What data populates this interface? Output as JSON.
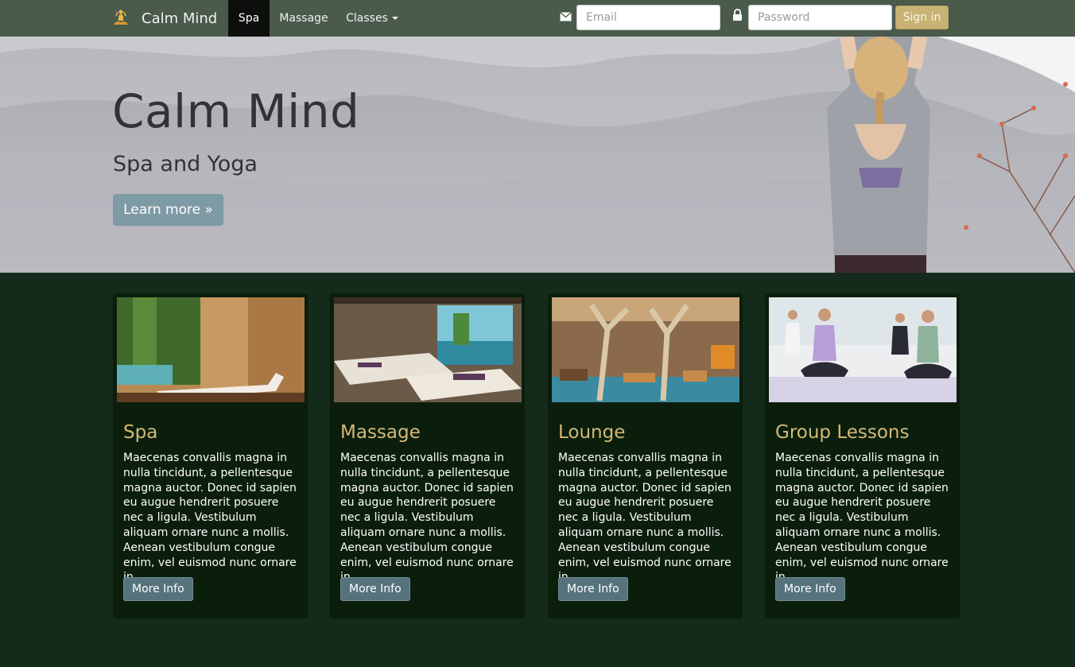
{
  "nav": {
    "brand": "Calm Mind",
    "links": [
      {
        "label": "Spa",
        "active": true
      },
      {
        "label": "Massage",
        "active": false
      },
      {
        "label": "Classes",
        "active": false
      }
    ],
    "email_placeholder": "Email",
    "password_placeholder": "Password",
    "signin_label": "Sign in",
    "brand_icon": "meditation-figure-icon",
    "email_icon": "envelope-icon",
    "password_icon": "lock-icon"
  },
  "hero": {
    "title": "Calm Mind",
    "subtitle": "Spa and Yoga",
    "button_label": "Learn more »"
  },
  "cards": [
    {
      "title": "Spa",
      "text": "Maecenas convallis magna in nulla tincidunt, a pellentesque magna auctor. Donec id sapien eu augue hendrerit posuere nec a ligula. Vestibulum aliquam ornare nunc a mollis. Aenean vestibulum congue enim, vel euismod nunc ornare in.",
      "button_label": "More Info"
    },
    {
      "title": "Massage",
      "text": "Maecenas convallis magna in nulla tincidunt, a pellentesque magna auctor. Donec id sapien eu augue hendrerit posuere nec a ligula. Vestibulum aliquam ornare nunc a mollis. Aenean vestibulum congue enim, vel euismod nunc ornare in.",
      "button_label": "More Info"
    },
    {
      "title": "Lounge",
      "text": "Maecenas convallis magna in nulla tincidunt, a pellentesque magna auctor. Donec id sapien eu augue hendrerit posuere nec a ligula. Vestibulum aliquam ornare nunc a mollis. Aenean vestibulum congue enim, vel euismod nunc ornare in.",
      "button_label": "More Info"
    },
    {
      "title": "Group Lessons",
      "text": "Maecenas convallis magna in nulla tincidunt, a pellentesque magna auctor. Donec id sapien eu augue hendrerit posuere nec a ligula. Vestibulum aliquam ornare nunc a mollis. Aenean vestibulum congue enim, vel euismod nunc ornare in.",
      "button_label": "More Info"
    }
  ],
  "colors": {
    "navbar": "#4a5a4b",
    "page_background": "#142a1b",
    "card_background": "#0b1e0c",
    "accent_gold": "#d4b977",
    "signin_button": "#c9b273",
    "button_slate": "#56737d",
    "hero_button": "#7e9aa4"
  }
}
